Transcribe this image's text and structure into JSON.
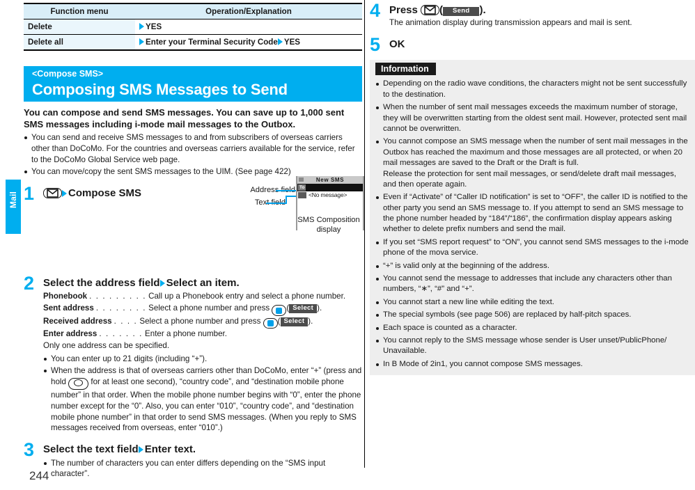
{
  "sidebar": {
    "tab_label": "Mail"
  },
  "page_number": "244",
  "function_table": {
    "headers": [
      "Function menu",
      "Operation/Explanation"
    ],
    "rows": [
      {
        "menu": "Delete",
        "operation": "YES"
      },
      {
        "menu": "Delete all",
        "operation_1": "Enter your Terminal Security Code",
        "operation_2": "YES"
      }
    ]
  },
  "section": {
    "subtitle": "<Compose SMS>",
    "title": "Composing SMS Messages to Send",
    "lead": "You can compose and send SMS messages. You can save up to 1,000 sent SMS messages including i-mode mail messages to the Outbox.",
    "bullets": [
      "You can send and receive SMS messages to and from subscribers of overseas carriers other than DoCoMo. For the countries and overseas carriers available for the service, refer to the DoCoMo Global Service web page.",
      "You can move/copy the sent SMS messages to the UIM. (See page 422)"
    ]
  },
  "steps": {
    "step1": {
      "number": "1",
      "key_icon": "mail-key-icon",
      "head_text": "Compose SMS"
    },
    "step2": {
      "number": "2",
      "head_1": "Select the address field",
      "head_2": "Select an item.",
      "items": [
        {
          "term": "Phonebook",
          "dots": ". . . . . . . . .",
          "desc": "Call up a Phonebook entry and select a phone number."
        },
        {
          "term": "Sent address",
          "dots": ". . . . . . . .",
          "desc_before": "Select a phone number and press",
          "softkey": "Select",
          "desc_after": ")."
        },
        {
          "term": "Received address",
          "dots": ". . . .",
          "desc_before": "Select a phone number and press",
          "softkey": "Select",
          "desc_after": ")."
        },
        {
          "term": "Enter address",
          "dots": ". . . . . . .",
          "desc": "Enter a phone number."
        }
      ],
      "note_line": "Only one address can be specified.",
      "bullets": [
        "You can enter up to 21 digits (including “+”).",
        "When the address is that of overseas carriers other than DoCoMo, enter “+” (press and hold"
      ],
      "bullet2_rest": "for at least one second), “country code”, and “destination mobile phone number” in that order. When the mobile phone number begins with “0”, enter the phone number except for the “0”. Also, you can enter “010”, “country code”, and “destination mobile phone number” in that order to send SMS messages. (When you reply to SMS messages received from overseas, enter “010”.)"
    },
    "step3": {
      "number": "3",
      "head_1": "Select the text field",
      "head_2": "Enter text.",
      "bullets": [
        "The number of characters you can enter differs depending on the “SMS input character”."
      ]
    },
    "step4": {
      "number": "4",
      "head_before": "Press",
      "key_icon": "mail-key-icon",
      "softkey": "Send",
      "head_after": ").",
      "body": "The animation display during transmission appears and mail is sent."
    },
    "step5": {
      "number": "5",
      "head": "OK"
    }
  },
  "phone_mock": {
    "callout_address": "Address field",
    "callout_text": "Text field",
    "caption_line1": "SMS Composition",
    "caption_line2": "display",
    "screen_title": "New SMS",
    "to_badge": "To",
    "message_placeholder": "<No message>"
  },
  "information": {
    "heading": "Information",
    "items": [
      "Depending on the radio wave conditions, the characters might not be sent successfully to the destination.",
      "When the number of sent mail messages exceeds the maximum number of storage, they will be overwritten starting from the oldest sent mail. However, protected sent mail cannot be overwritten.",
      "You cannot compose an SMS message when the number of sent mail messages in the Outbox has reached the maximum and those messages are all protected, or when 20 mail messages are saved to the Draft or the Draft is full.",
      "Even if “Activate” of “Caller ID notification” is set to “OFF”, the caller ID is notified to the other party you send an SMS message to. If you attempt to send an SMS message to the phone number headed by “184”/“186”, the confirmation display appears asking whether to delete prefix numbers and send the mail.",
      "If you set “SMS report request” to “ON”, you cannot send SMS messages to the i-mode phone of the mova service.",
      "“+” is valid only at the beginning of the address.",
      "You cannot send the message to addresses that include any characters other than numbers, “∗”, “#” and “+”.",
      "You cannot start a new line while editing the text.",
      "The special symbols (see page 506) are replaced by half-pitch spaces.",
      "Each space is counted as a character.",
      "You cannot reply to the SMS message whose sender is User unset/PublicPhone/ Unavailable.",
      "In B Mode of 2in1, you cannot compose SMS messages."
    ],
    "item3_sub": "Release the protection for sent mail messages, or send/delete draft mail messages, and then operate again."
  },
  "colors": {
    "accent": "#00aeef",
    "table_header_bg": "#d9eef8",
    "table_cell_bg": "#eaf6fc",
    "info_bg": "#eeeeee",
    "softkey_bg": "#4c4c4c"
  }
}
